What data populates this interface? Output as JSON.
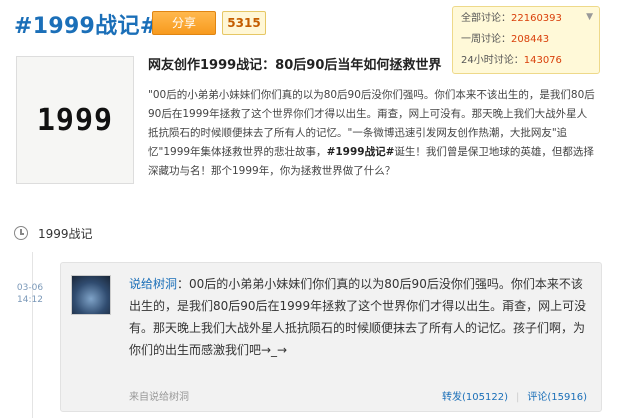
{
  "header": {
    "title": "#1999战记#",
    "share_label": "分享",
    "share_count": "5315"
  },
  "stats": {
    "total_label": "全部讨论：",
    "total_value": "22160393",
    "week_label": "一周讨论：",
    "week_value": "208443",
    "day_label": "24小时讨论：",
    "day_value": "143076"
  },
  "topic": {
    "cover_text": "1999",
    "headline": "网友创作1999战记：80后90后当年如何拯救世界",
    "description_1": "\"00后的小弟弟小妹妹们你们真的以为80后90后没你们强吗。你们本来不该出生的，是我们80后90后在1999年拯救了这个世界你们才得以出生。甭查，网上可没有。那天晚上我们大战外星人抵抗陨石的时候顺便抹去了所有人的记忆。\"一条微博迅速引发网友创作热潮，大批网友\"追忆\"1999年集体拯救世界的悲壮故事，",
    "description_tag": "#1999战记#",
    "description_2": "诞生！我们曾是保卫地球的英雄，但都选择深藏功与名！那个1999年，你为拯救世界做了什么？"
  },
  "section": {
    "title": "1999战记"
  },
  "post": {
    "date": "03-06",
    "time": "14:12",
    "author": "说给树洞",
    "text": "：00后的小弟弟小妹妹们你们真的以为80后90后没你们强吗。你们本来不该出生的，是我们80后90后在1999年拯救了这个世界你们才得以出生。甭查，网上可没有。那天晚上我们大战外星人抵抗陨石的时候顺便抹去了所有人的记忆。孩子们啊，为你们的出生而感激我们吧→_→",
    "source": "来自说给树洞",
    "repost": "转发(105122)",
    "comment": "评论(15916)"
  }
}
